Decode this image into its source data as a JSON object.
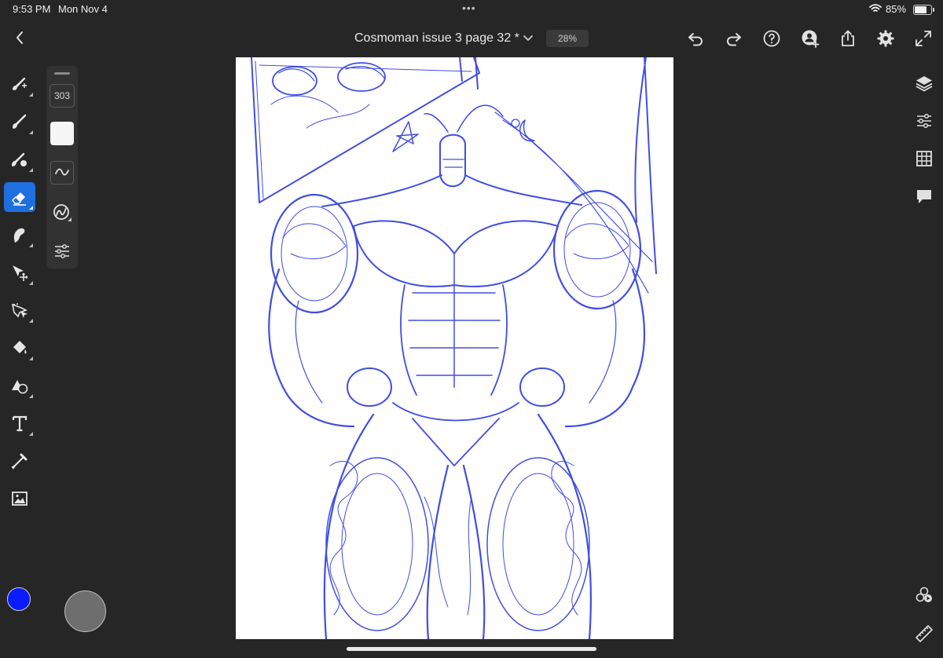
{
  "status_bar": {
    "time": "9:53 PM",
    "date": "Mon Nov 4",
    "battery_percent": "85%",
    "battery_level": 0.85,
    "multitask_dots": "•••"
  },
  "top_bar": {
    "title": "Cosmoman issue 3 page 32 *",
    "zoom": "28%",
    "icons": [
      "back-icon",
      "chevron-down-icon",
      "undo-icon",
      "redo-icon",
      "help-icon",
      "invite-icon",
      "share-icon",
      "settings-icon",
      "fullscreen-icon"
    ]
  },
  "tool_rail": {
    "tools": [
      "paint-brush",
      "pixel-brush",
      "live-brush",
      "eraser",
      "smudge",
      "transform",
      "selection",
      "fill",
      "shapes",
      "text",
      "eyedropper",
      "image"
    ],
    "active_tool": "eraser",
    "current_color": "#0a1cff"
  },
  "brush_panel": {
    "size": "303",
    "opacity_color": "#f5f5f5"
  },
  "right_rail": {
    "icons": [
      "layers-icon",
      "properties-icon",
      "grid-icon",
      "comments-icon",
      "recolor-icon",
      "ruler-icon"
    ]
  },
  "colors": {
    "accent": "#1f6fe0",
    "sketch": "#1f2fe0",
    "background": "#262626",
    "canvas": "#ffffff"
  }
}
